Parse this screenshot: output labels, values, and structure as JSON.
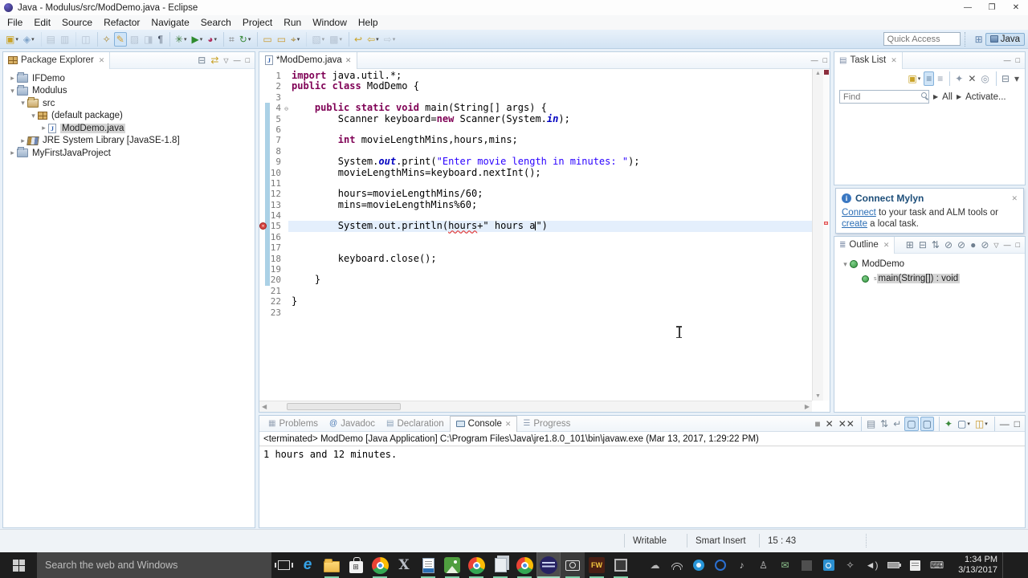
{
  "window": {
    "title": "Java - Modulus/src/ModDemo.java - Eclipse"
  },
  "menus": [
    "File",
    "Edit",
    "Source",
    "Refactor",
    "Navigate",
    "Search",
    "Project",
    "Run",
    "Window",
    "Help"
  ],
  "toolbar": {
    "quick_access_placeholder": "Quick Access",
    "perspective_label": "Java",
    "icons": [
      {
        "name": "new-wizard-icon",
        "glyph": "▣",
        "color": "#c9a227",
        "dd": 1
      },
      {
        "name": "new-java-class-icon",
        "glyph": "◈",
        "color": "#7fa3c9",
        "dd": 1
      },
      {
        "name": "save-icon",
        "glyph": "▤",
        "color": "#8a97a8",
        "grey": 1,
        "sep": 1
      },
      {
        "name": "save-all-icon",
        "glyph": "▥",
        "color": "#8a97a8",
        "grey": 1
      },
      {
        "name": "print-icon",
        "glyph": "◫",
        "color": "#8a97a8",
        "grey": 1,
        "sep": 1
      },
      {
        "name": "key-icon",
        "glyph": "✧",
        "color": "#a8842e",
        "sep": 1
      },
      {
        "name": "format-brush-icon",
        "glyph": "✎",
        "color": "#d8a030",
        "hl": 1
      },
      {
        "name": "mark-occurrences-icon",
        "glyph": "▨",
        "color": "#8a97a8",
        "grey": 1
      },
      {
        "name": "externalize-strings-icon",
        "glyph": "◨",
        "color": "#8a97a8",
        "grey": 1
      },
      {
        "name": "show-whitespace-icon",
        "glyph": "¶",
        "color": "#4a5568"
      },
      {
        "name": "debug-icon",
        "glyph": "✳",
        "color": "#3a7a3a",
        "dd": 1,
        "sep": 1
      },
      {
        "name": "run-icon",
        "glyph": "▶",
        "color": "#2e8b2e",
        "dd": 1
      },
      {
        "name": "run-last-icon",
        "glyph": "◕",
        "color": "#b03060",
        "dd": 1
      },
      {
        "name": "new-java-ee-icon",
        "glyph": "⌗",
        "color": "#777777",
        "sep": 1
      },
      {
        "name": "refresh-icon",
        "glyph": "↻",
        "color": "#3a8a3a",
        "dd": 1
      },
      {
        "name": "open-folder-icon",
        "glyph": "▭",
        "color": "#c9992e",
        "sep": 1
      },
      {
        "name": "open-folder-2-icon",
        "glyph": "▭",
        "color": "#c9992e"
      },
      {
        "name": "search-torch-icon",
        "glyph": "⌖",
        "color": "#a8842e",
        "dd": 1
      },
      {
        "name": "annotation-prev-icon",
        "glyph": "▧",
        "color": "#8a97a8",
        "grey": 1,
        "dd": 1,
        "sep": 1
      },
      {
        "name": "annotation-next-icon",
        "glyph": "▩",
        "color": "#8a97a8",
        "grey": 1,
        "dd": 1
      },
      {
        "name": "last-edit-location-icon",
        "glyph": "↩",
        "color": "#c9a227",
        "sep": 1
      },
      {
        "name": "back-icon",
        "glyph": "⇦",
        "color": "#c9a227",
        "dd": 1
      },
      {
        "name": "forward-icon",
        "glyph": "⇨",
        "color": "#9aa4ae",
        "grey": 1,
        "dd": 1
      }
    ]
  },
  "package_explorer": {
    "title": "Package Explorer",
    "header_icons": [
      {
        "name": "collapse-all-icon",
        "glyph": "⊟",
        "color": "#6f7f8f"
      },
      {
        "name": "link-with-editor-icon",
        "glyph": "⇄",
        "color": "#c9a227"
      }
    ],
    "items": [
      {
        "label": "IFDemo",
        "indent": 0,
        "arrow": "▸",
        "icon": "project"
      },
      {
        "label": "Modulus",
        "indent": 0,
        "arrow": "▾",
        "icon": "project"
      },
      {
        "label": "src",
        "indent": 1,
        "arrow": "▾",
        "icon": "src"
      },
      {
        "label": "(default package)",
        "indent": 2,
        "arrow": "▾",
        "icon": "pkg"
      },
      {
        "label": "ModDemo.java",
        "indent": 3,
        "arrow": "▸",
        "icon": "jfile",
        "selected": true
      },
      {
        "label": "JRE System Library [JavaSE-1.8]",
        "indent": 1,
        "arrow": "▸",
        "icon": "lib"
      },
      {
        "label": "MyFirstJavaProject",
        "indent": 0,
        "arrow": "▸",
        "icon": "project"
      }
    ]
  },
  "editor": {
    "tab": "*ModDemo.java",
    "lines": [
      {
        "n": 1,
        "seg": [
          [
            "kw",
            "import"
          ],
          [
            "pl",
            " java.util.*;"
          ]
        ]
      },
      {
        "n": 2,
        "seg": [
          [
            "kw",
            "public class"
          ],
          [
            "pl",
            " ModDemo {"
          ]
        ]
      },
      {
        "n": 3,
        "seg": []
      },
      {
        "n": 4,
        "fold": true,
        "bar": true,
        "seg": [
          [
            "pl",
            "    "
          ],
          [
            "kw",
            "public static void"
          ],
          [
            "pl",
            " main(String[] args) {"
          ]
        ]
      },
      {
        "n": 5,
        "bar": true,
        "seg": [
          [
            "pl",
            "        Scanner keyboard="
          ],
          [
            "kw",
            "new"
          ],
          [
            "pl",
            " Scanner(System."
          ],
          [
            "sf",
            "in"
          ],
          [
            "pl",
            ");"
          ]
        ]
      },
      {
        "n": 6,
        "bar": true,
        "seg": []
      },
      {
        "n": 7,
        "bar": true,
        "seg": [
          [
            "pl",
            "        "
          ],
          [
            "kw",
            "int"
          ],
          [
            "pl",
            " movieLengthMins,hours,mins;"
          ]
        ]
      },
      {
        "n": 8,
        "bar": true,
        "seg": []
      },
      {
        "n": 9,
        "bar": true,
        "seg": [
          [
            "pl",
            "        System."
          ],
          [
            "sf",
            "out"
          ],
          [
            "pl",
            ".print("
          ],
          [
            "st",
            "\"Enter movie length in minutes: \""
          ],
          [
            "pl",
            ");"
          ]
        ]
      },
      {
        "n": 10,
        "bar": true,
        "seg": [
          [
            "pl",
            "        movieLengthMins=keyboard.nextInt();"
          ]
        ]
      },
      {
        "n": 11,
        "bar": true,
        "seg": []
      },
      {
        "n": 12,
        "bar": true,
        "seg": [
          [
            "pl",
            "        hours=movieLengthMins/60;"
          ]
        ]
      },
      {
        "n": 13,
        "bar": true,
        "seg": [
          [
            "pl",
            "        mins=movieLengthMins%60;"
          ]
        ]
      },
      {
        "n": 14,
        "bar": true,
        "seg": []
      },
      {
        "n": 15,
        "bar": true,
        "cur": true,
        "err": true,
        "seg": [
          [
            "pl",
            "        System.out.println("
          ],
          [
            "err",
            "hours"
          ],
          [
            "pl",
            "+\" hours a"
          ],
          [
            "caret",
            ""
          ],
          [
            "pl",
            "\")"
          ]
        ]
      },
      {
        "n": 16,
        "bar": true,
        "seg": []
      },
      {
        "n": 17,
        "bar": true,
        "seg": []
      },
      {
        "n": 18,
        "bar": true,
        "seg": [
          [
            "pl",
            "        keyboard.close();"
          ]
        ]
      },
      {
        "n": 19,
        "bar": true,
        "seg": []
      },
      {
        "n": 20,
        "bar": true,
        "seg": [
          [
            "pl",
            "    }"
          ]
        ]
      },
      {
        "n": 21,
        "seg": []
      },
      {
        "n": 22,
        "seg": [
          [
            "pl",
            "}"
          ]
        ]
      },
      {
        "n": 23,
        "seg": []
      }
    ]
  },
  "task_list": {
    "title": "Task List",
    "find_placeholder": "Find",
    "all_label": "All",
    "activate_label": "Activate...",
    "icons": [
      {
        "name": "new-task-icon",
        "glyph": "▣",
        "color": "#c9a227",
        "dd": 1
      },
      {
        "name": "group-by-category-icon",
        "glyph": "≡",
        "color": "#5a7a9a",
        "hl": 1
      },
      {
        "name": "group-by-icon",
        "glyph": "≡",
        "color": "#8a97a8"
      },
      {
        "name": "scheduled-presentation-icon",
        "glyph": "✦",
        "color": "#8a97a8",
        "sep": 1
      },
      {
        "name": "remove-task-icon",
        "glyph": "✕",
        "color": "#555555"
      },
      {
        "name": "focus-workweek-icon",
        "glyph": "◎",
        "color": "#8a97a8"
      },
      {
        "name": "collapse-all-icon",
        "glyph": "⊟",
        "color": "#6f7f8f",
        "sep": 1
      },
      {
        "name": "view-menu-icon",
        "glyph": "▾",
        "color": "#555555"
      }
    ]
  },
  "mylyn": {
    "title": "Connect Mylyn",
    "link_connect": "Connect",
    "body_mid": " to your task and ALM tools or ",
    "link_create": "create",
    "body_end": " a local task."
  },
  "outline": {
    "title": "Outline",
    "root": "ModDemo",
    "child_main": "main(String[]) : void",
    "icons": [
      {
        "name": "expand-all-icon",
        "glyph": "⊞",
        "color": "#6f7f8f"
      },
      {
        "name": "collapse-all-icon",
        "glyph": "⊟",
        "color": "#6f7f8f"
      },
      {
        "name": "sort-icon",
        "glyph": "⇅",
        "color": "#6f7f8f"
      },
      {
        "name": "hide-fields-icon",
        "glyph": "⊘",
        "color": "#6f7f8f"
      },
      {
        "name": "hide-static-members-icon",
        "glyph": "⊘",
        "color": "#6f7f8f"
      },
      {
        "name": "hide-non-public-icon",
        "glyph": "●",
        "color": "#6f7f8f"
      },
      {
        "name": "hide-local-types-icon",
        "glyph": "⊘",
        "color": "#6f7f8f"
      }
    ]
  },
  "console": {
    "tabs": [
      {
        "label": "Problems",
        "icon": "problems"
      },
      {
        "label": "Javadoc",
        "icon": "javadoc"
      },
      {
        "label": "Declaration",
        "icon": "declaration"
      },
      {
        "label": "Console",
        "icon": "console",
        "active": true
      },
      {
        "label": "Progress",
        "icon": "progress"
      }
    ],
    "header": "<terminated> ModDemo [Java Application] C:\\Program Files\\Java\\jre1.8.0_101\\bin\\javaw.exe (Mar 13, 2017, 1:29:22 PM)",
    "output": "1 hours and 12 minutes.",
    "toolbar_icons": [
      {
        "name": "terminate-icon",
        "glyph": "■",
        "color": "#9a9a9a"
      },
      {
        "name": "remove-launch-icon",
        "glyph": "✕",
        "color": "#444444"
      },
      {
        "name": "remove-all-terminated-icon",
        "glyph": "✕✕",
        "color": "#444444"
      },
      {
        "name": "clear-console-icon",
        "glyph": "▤",
        "color": "#7a8a9a",
        "sep": 1
      },
      {
        "name": "scroll-lock-icon",
        "glyph": "⇅",
        "color": "#7a8a9a"
      },
      {
        "name": "word-wrap-icon",
        "glyph": "↵",
        "color": "#7a8a9a"
      },
      {
        "name": "show-stdout-icon",
        "glyph": "▢",
        "color": "#4a6a8a",
        "hl": 1
      },
      {
        "name": "show-stderr-icon",
        "glyph": "▢",
        "color": "#4a6a8a",
        "hl": 1
      },
      {
        "name": "pin-console-icon",
        "glyph": "✦",
        "color": "#3a8a3a",
        "sep": 1
      },
      {
        "name": "display-selected-console-icon",
        "glyph": "▢",
        "color": "#4a6a8a",
        "dd": 1
      },
      {
        "name": "open-console-icon",
        "glyph": "◫",
        "color": "#c9992e",
        "dd": 1
      },
      {
        "name": "minimize-icon",
        "glyph": "—",
        "color": "#555555",
        "sep": 1
      },
      {
        "name": "maximize-icon",
        "glyph": "□",
        "color": "#555555"
      }
    ]
  },
  "status_bar": {
    "writable": "Writable",
    "insert_mode": "Smart Insert",
    "position": "15 : 43"
  },
  "taskbar": {
    "search_placeholder": "Search the web and Windows",
    "clock_time": "1:34 PM",
    "clock_date": "3/13/2017",
    "apps": [
      {
        "name": "edge",
        "kind": "glyph",
        "glyph": "e",
        "color": "#35a3e8"
      },
      {
        "name": "file-explorer",
        "kind": "folder",
        "run": true
      },
      {
        "name": "store",
        "kind": "store"
      },
      {
        "name": "chrome-1",
        "kind": "chrome",
        "run": true
      },
      {
        "name": "xming",
        "kind": "xglyph",
        "glyph": "X"
      },
      {
        "name": "writer",
        "kind": "writer",
        "run": true
      },
      {
        "name": "image-app",
        "kind": "green",
        "run": true
      },
      {
        "name": "chrome-2",
        "kind": "chrome",
        "run": true
      },
      {
        "name": "notepad",
        "kind": "notepad",
        "run": true
      },
      {
        "name": "chrome-3",
        "kind": "chrome",
        "run": true
      },
      {
        "name": "eclipse",
        "kind": "eclipse",
        "run": true,
        "active": true
      },
      {
        "name": "camera-app",
        "kind": "camera",
        "run": true,
        "lit": true
      },
      {
        "name": "fw-app",
        "kind": "fw",
        "glyph": "FW",
        "run": true
      },
      {
        "name": "window-app",
        "kind": "winsq",
        "run": true
      }
    ],
    "tray": [
      {
        "name": "onedrive-icon",
        "kind": "glyph",
        "glyph": "☁",
        "color": "#b5b5b5"
      },
      {
        "name": "wifi-icon",
        "kind": "wifi"
      },
      {
        "name": "blue-app-icon",
        "kind": "bluedot"
      },
      {
        "name": "browser-tray-icon",
        "kind": "bluedot2"
      },
      {
        "name": "audio-tray-icon",
        "kind": "glyph",
        "glyph": "♪",
        "color": "#c8c8c8"
      },
      {
        "name": "device-settings-icon",
        "kind": "glyph",
        "glyph": "♙",
        "color": "#c8c8c8"
      },
      {
        "name": "mail-tray-icon",
        "kind": "glyph",
        "glyph": "✉",
        "color": "#8cc08c"
      },
      {
        "name": "app-tray-icon",
        "kind": "darksq"
      },
      {
        "name": "power-tray-icon",
        "kind": "power"
      },
      {
        "name": "antenna-tray-icon",
        "kind": "glyph",
        "glyph": "✧",
        "color": "#c8c8c8"
      },
      {
        "name": "volume-icon",
        "kind": "glyph",
        "glyph": "◄)",
        "color": "#d0d0d0"
      },
      {
        "name": "battery-icon",
        "kind": "battery"
      },
      {
        "name": "notes-icon",
        "kind": "notes"
      },
      {
        "name": "keyboard-icon",
        "kind": "glyph",
        "glyph": "⌨",
        "color": "#d0d0d0"
      }
    ]
  }
}
